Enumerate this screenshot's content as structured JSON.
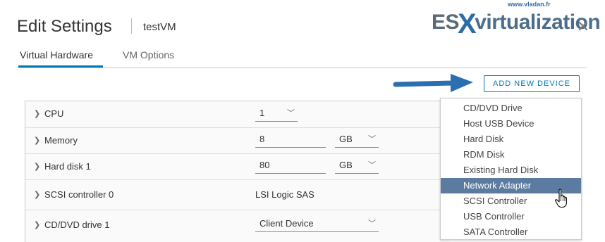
{
  "dialog": {
    "title": "Edit Settings",
    "vm_name": "testVM",
    "close_glyph": "✕"
  },
  "brand": {
    "url": "www.vladan.fr",
    "es": "ES",
    "x": "X",
    "rest": "virtualization"
  },
  "tabs": [
    {
      "label": "Virtual Hardware",
      "active": true
    },
    {
      "label": "VM Options",
      "active": false
    }
  ],
  "toolbar": {
    "add_device_label": "ADD NEW DEVICE"
  },
  "hardware": [
    {
      "label": "CPU",
      "value": "1",
      "unit": ""
    },
    {
      "label": "Memory",
      "value": "8",
      "unit": "GB"
    },
    {
      "label": "Hard disk 1",
      "value": "80",
      "unit": "GB"
    },
    {
      "label": "SCSI controller 0",
      "value": "LSI Logic SAS",
      "unit": ""
    },
    {
      "label": "CD/DVD drive 1",
      "value": "Client Device",
      "unit": ""
    }
  ],
  "device_menu": [
    {
      "label": "CD/DVD Drive",
      "selected": false
    },
    {
      "label": "Host USB Device",
      "selected": false
    },
    {
      "label": "Hard Disk",
      "selected": false
    },
    {
      "label": "RDM Disk",
      "selected": false
    },
    {
      "label": "Existing Hard Disk",
      "selected": false
    },
    {
      "label": "Network Adapter",
      "selected": true
    },
    {
      "label": "SCSI Controller",
      "selected": false
    },
    {
      "label": "USB Controller",
      "selected": false
    },
    {
      "label": "SATA Controller",
      "selected": false
    }
  ],
  "colors": {
    "accent": "#0079b8",
    "selected_bg": "#5b7ca0",
    "annotation_arrow": "#2a6fb0"
  }
}
